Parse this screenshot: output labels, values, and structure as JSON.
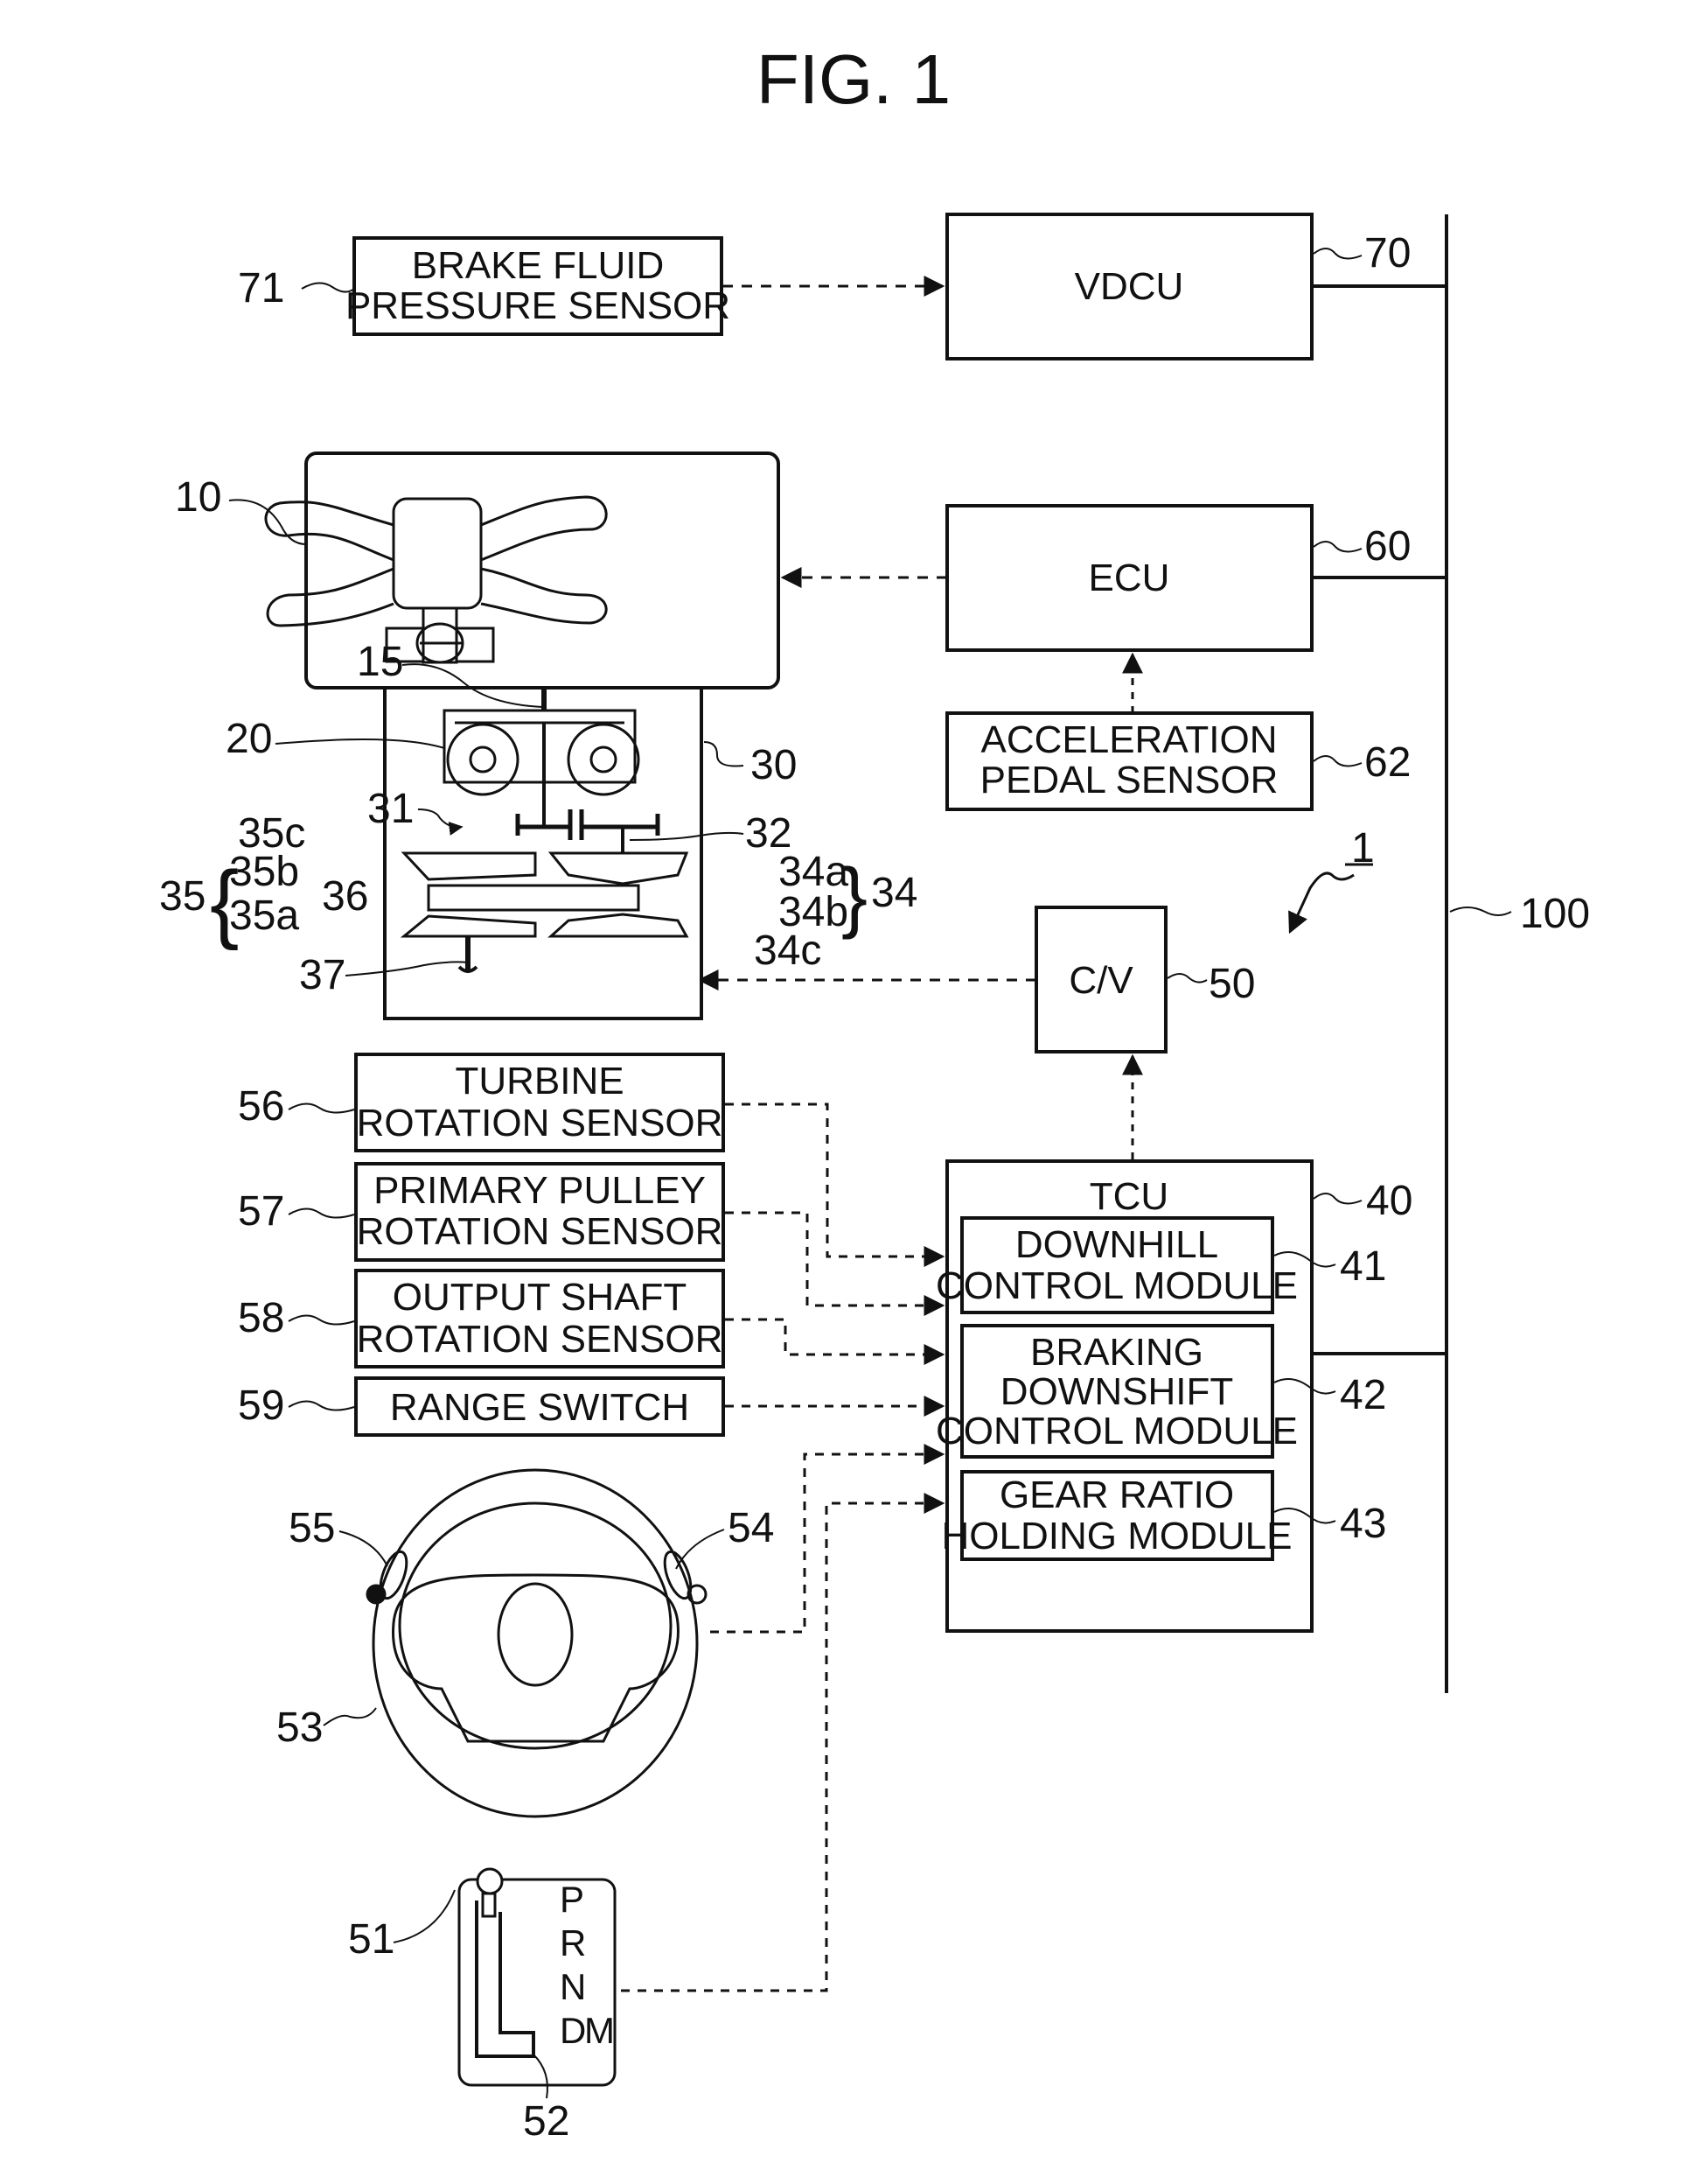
{
  "figure": {
    "title": "FIG. 1",
    "system_ref": "1"
  },
  "blocks": {
    "brake_sensor": {
      "ref": "71",
      "lines": [
        "BRAKE FLUID",
        "PRESSURE SENSOR"
      ]
    },
    "vdcu": {
      "ref": "70",
      "label": "VDCU"
    },
    "ecu": {
      "ref": "60",
      "label": "ECU"
    },
    "accel_sensor": {
      "ref": "62",
      "lines": [
        "ACCELERATION",
        "PEDAL SENSOR"
      ]
    },
    "cv": {
      "ref": "50",
      "label": "C/V"
    },
    "bus": {
      "ref": "100"
    },
    "tcu": {
      "ref": "40",
      "label": "TCU",
      "modules": [
        {
          "ref": "41",
          "lines": [
            "DOWNHILL",
            "CONTROL MODULE"
          ]
        },
        {
          "ref": "42",
          "lines": [
            "BRAKING",
            "DOWNSHIFT",
            "CONTROL MODULE"
          ]
        },
        {
          "ref": "43",
          "lines": [
            "GEAR RATIO",
            "HOLDING MODULE"
          ]
        }
      ]
    },
    "sensors": [
      {
        "ref": "56",
        "lines": [
          "TURBINE",
          "ROTATION SENSOR"
        ]
      },
      {
        "ref": "57",
        "lines": [
          "PRIMARY PULLEY",
          "ROTATION SENSOR"
        ]
      },
      {
        "ref": "58",
        "lines": [
          "OUTPUT SHAFT",
          "ROTATION SENSOR"
        ]
      },
      {
        "ref": "59",
        "lines": [
          "RANGE SWITCH"
        ]
      }
    ]
  },
  "mechanical": {
    "engine": "10",
    "crankshaft": "15",
    "torque_converter": "20",
    "transmission": "30",
    "forward_reverse": "31",
    "input_shaft": "32",
    "primary_pulley": "34",
    "primary_a": "34a",
    "primary_b": "34b",
    "primary_c": "34c",
    "secondary_pulley": "35",
    "secondary_a": "35a",
    "secondary_b": "35b",
    "secondary_c": "35c",
    "belt": "36",
    "output_shaft": "37"
  },
  "driver_controls": {
    "steering_wheel": "53",
    "upshift_paddle": "54",
    "downshift_paddle": "55",
    "select_lever": "51",
    "gate": "52",
    "gate_positions": [
      "P",
      "R",
      "N",
      "D"
    ],
    "manual_position": "M"
  }
}
